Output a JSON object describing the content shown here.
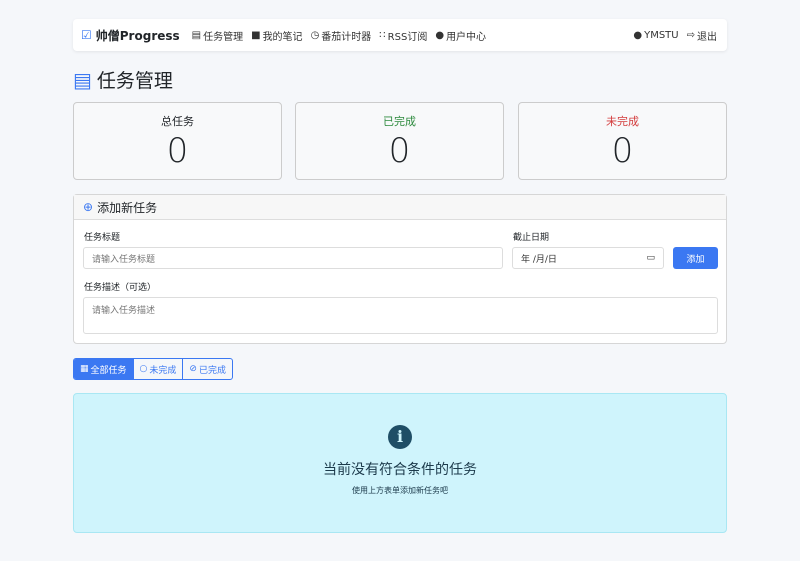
{
  "nav": {
    "brand": "帅僧Progress",
    "items": [
      {
        "icon": "list-alt-icon",
        "glyph": "▤",
        "label": "任务管理"
      },
      {
        "icon": "note-icon",
        "glyph": "■",
        "label": "我的笔记"
      },
      {
        "icon": "clock-icon",
        "glyph": "◷",
        "label": "番茄计时器"
      },
      {
        "icon": "rss-icon",
        "glyph": "∷",
        "label": "RSS订阅"
      },
      {
        "icon": "user-icon",
        "glyph": "●",
        "label": "用户中心"
      }
    ],
    "user": "YMSTU",
    "logout": "退出"
  },
  "page": {
    "title": "任务管理"
  },
  "stats": [
    {
      "label": "总任务",
      "value": "0",
      "color": "#212529"
    },
    {
      "label": "已完成",
      "value": "0",
      "color": "#2e8b3e"
    },
    {
      "label": "未完成",
      "value": "0",
      "color": "#d33c3c"
    }
  ],
  "form": {
    "header": "添加新任务",
    "title_label": "任务标题",
    "title_placeholder": "请输入任务标题",
    "date_label": "截止日期",
    "date_value": "年 /月/日",
    "add": "添加",
    "desc_label": "任务描述（可选）",
    "desc_placeholder": "请输入任务描述"
  },
  "filters": [
    "全部任务",
    "未完成",
    "已完成"
  ],
  "empty": {
    "title": "当前没有符合条件的任务",
    "subtitle": "使用上方表单添加新任务吧"
  }
}
